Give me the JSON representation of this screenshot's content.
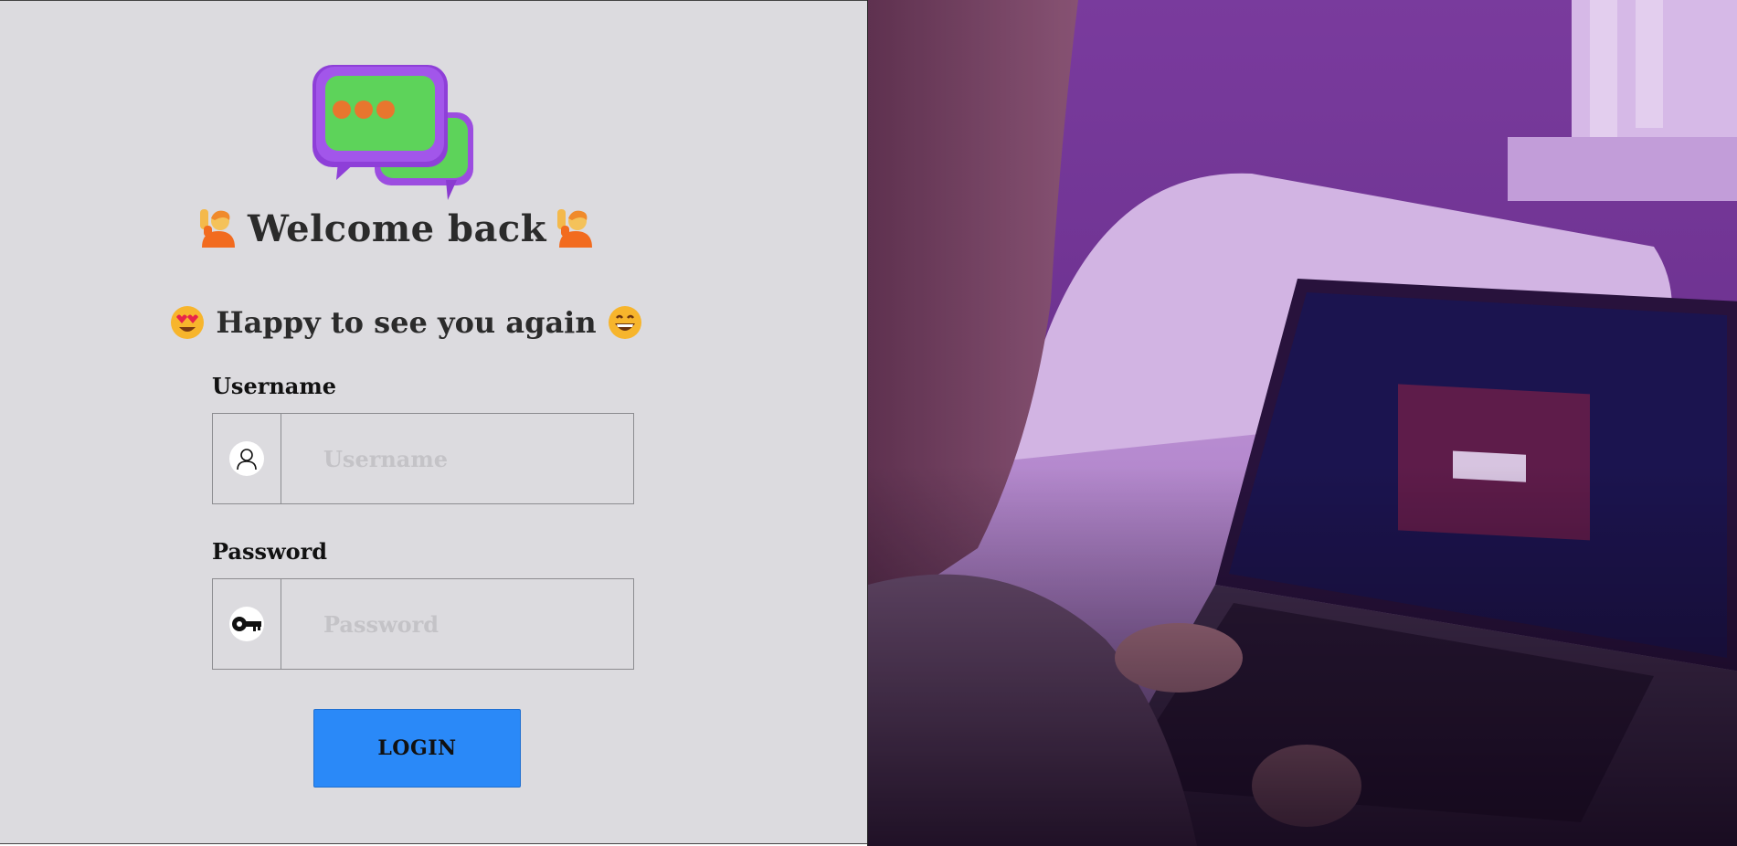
{
  "header": {
    "title": "Welcome back",
    "subtitle": "Happy to see you again"
  },
  "form": {
    "username_label": "Username",
    "username_placeholder": "Username",
    "password_label": "Password",
    "password_placeholder": "Password",
    "login_label": "LOGIN"
  },
  "icons": {
    "logo": "chat-bubbles-icon",
    "welcome_left": "person-raising-hand-emoji",
    "welcome_right": "person-raising-hand-emoji",
    "subtitle_left": "heart-eyes-emoji",
    "subtitle_right": "grinning-face-emoji",
    "username": "user-icon",
    "password": "key-icon"
  },
  "colors": {
    "left_panel_bg": "#dcdbdf",
    "button": "#2a89f8",
    "photo_tint": "#6b2a9a"
  }
}
